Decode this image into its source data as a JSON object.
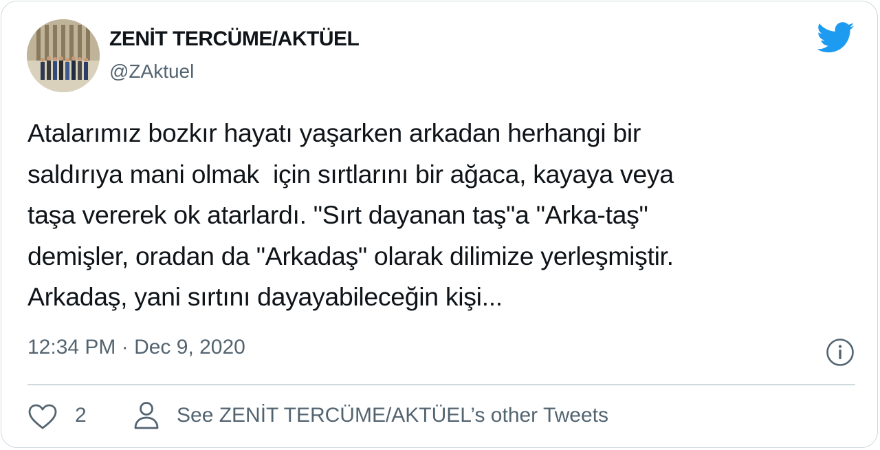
{
  "author": {
    "name": "ZENİT TERCÜME/AKTÜEL",
    "handle": "@ZAktuel",
    "avatar_icon": "group-photo-avatar"
  },
  "brand": {
    "icon": "twitter-bird-icon",
    "color": "#1d9bf0"
  },
  "tweet": {
    "lines": [
      "Atalarımız bozkır hayatı yaşarken arkadan herhangi bir",
      "saldırıya mani olmak  için sırtlarını bir ağaca, kayaya veya",
      "taşa vererek ok atarlardı. \"Sırt dayanan taş\"a \"Arka-taş\"",
      "demişler, oradan da \"Arkadaş\" olarak dilimize yerleşmiştir.",
      "Arkadaş, yani sırtını dayayabileceğin kişi..."
    ]
  },
  "meta": {
    "timestamp": "12:34 PM · Dec 9, 2020",
    "info_icon": "info-icon"
  },
  "actions": {
    "like_icon": "heart-icon",
    "like_count": "2",
    "profile_icon": "person-icon",
    "see_more_label": "See ZENİT TERCÜME/AKTÜEL’s other Tweets"
  },
  "colors": {
    "text_primary": "#0f1419",
    "text_secondary": "#536471",
    "border": "#cfd9de"
  }
}
